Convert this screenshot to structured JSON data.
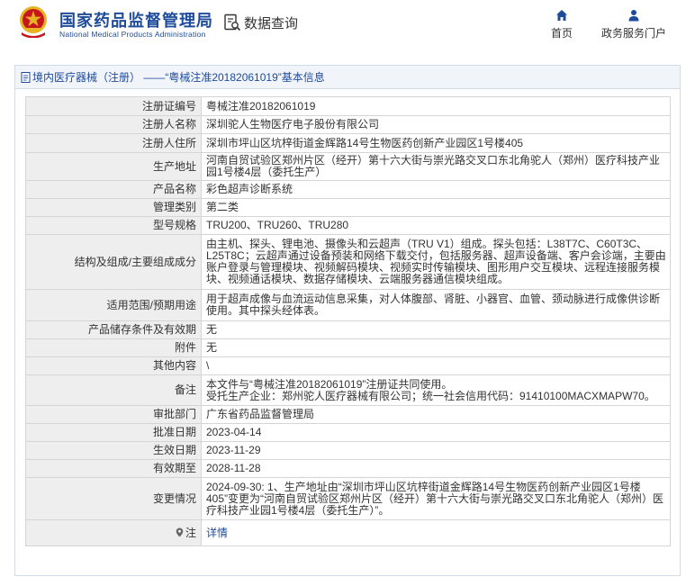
{
  "header": {
    "brand_cn": "国家药品监督管理局",
    "brand_en": "National Medical Products Administration",
    "query_label": "数据查询",
    "nav_home": "首页",
    "nav_portal": "政务服务门户",
    "brand_color": "#1f4b9b",
    "logo_red": "#c8161d",
    "logo_gold": "#e6b422"
  },
  "panel": {
    "title": "境内医疗器械（注册） ——“粤械注准20182061019”基本信息"
  },
  "rows": [
    {
      "label": "注册证编号",
      "value": "粤械注准20182061019"
    },
    {
      "label": "注册人名称",
      "value": "深圳驼人生物医疗电子股份有限公司"
    },
    {
      "label": "注册人住所",
      "value": "深圳市坪山区坑梓街道金辉路14号生物医药创新产业园区1号楼405"
    },
    {
      "label": "生产地址",
      "value": "河南自贸试验区郑州片区（经开）第十六大街与崇光路交叉口东北角驼人（郑州）医疗科技产业园1号楼4层（委托生产）"
    },
    {
      "label": "产品名称",
      "value": "彩色超声诊断系统"
    },
    {
      "label": "管理类别",
      "value": "第二类"
    },
    {
      "label": "型号规格",
      "value": "TRU200、TRU260、TRU280"
    },
    {
      "label": "结构及组成/主要组成成分",
      "value": "由主机、探头、锂电池、摄像头和云超声（TRU V1）组成。探头包括：L38T7C、C60T3C、L25T8C；云超声通过设备预装和网络下载交付，包括服务器、超声设备端、客户会诊端，主要由账户登录与管理模块、视频解码模块、视频实时传输模块、图形用户交互模块、远程连接服务模块、视频通话模块、数据存储模块、云端服务器通信模块组成。"
    },
    {
      "label": "适用范围/预期用途",
      "value": "用于超声成像与血流运动信息采集，对人体腹部、肾脏、小器官、血管、颈动脉进行成像供诊断使用。其中探头经体表。"
    },
    {
      "label": "产品储存条件及有效期",
      "value": "无"
    },
    {
      "label": "附件",
      "value": "无"
    },
    {
      "label": "其他内容",
      "value": "\\"
    },
    {
      "label": "备注",
      "value": "本文件与“粤械注准20182061019”注册证共同使用。\n受托生产企业：郑州驼人医疗器械有限公司；统一社会信用代码：91410100MACXMAPW70。"
    },
    {
      "label": "审批部门",
      "value": "广东省药品监督管理局"
    },
    {
      "label": "批准日期",
      "value": "2023-04-14"
    },
    {
      "label": "生效日期",
      "value": "2023-11-29"
    },
    {
      "label": "有效期至",
      "value": "2028-11-28"
    },
    {
      "label": "变更情况",
      "value": "2024-09-30: 1、生产地址由“深圳市坪山区坑梓街道金辉路14号生物医药创新产业园区1号楼405”变更为“河南自贸试验区郑州片区（经开）第十六大街与崇光路交叉口东北角驼人（郑州）医疗科技产业园1号楼4层（委托生产）”。"
    },
    {
      "label": "注",
      "value": "详情"
    }
  ]
}
